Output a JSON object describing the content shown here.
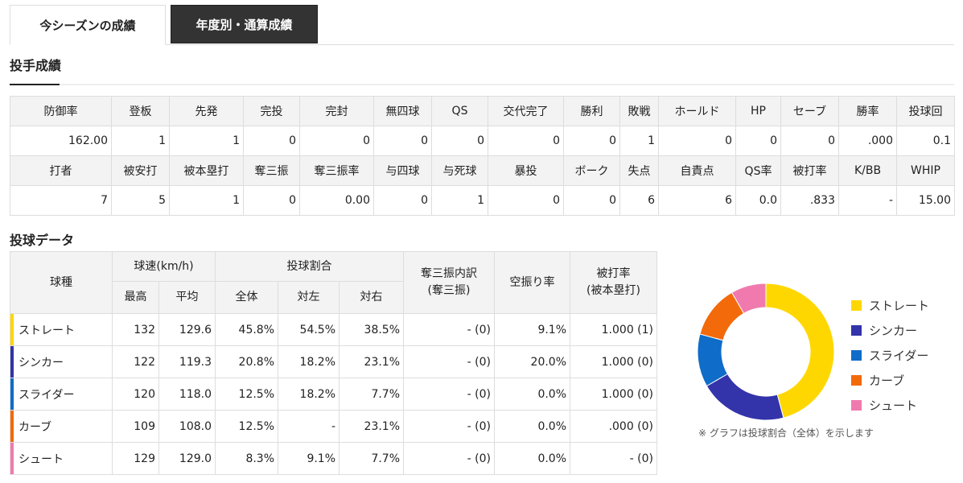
{
  "tabs": [
    {
      "label": "今シーズンの成績",
      "active": true
    },
    {
      "label": "年度別・通算成績",
      "active": false
    }
  ],
  "section_pitching": "投手成績",
  "stats": {
    "headers1": [
      "防御率",
      "登板",
      "先発",
      "完投",
      "完封",
      "無四球",
      "QS",
      "交代完了",
      "勝利",
      "敗戦",
      "ホールド",
      "HP",
      "セーブ",
      "勝率",
      "投球回"
    ],
    "values1": [
      "162.00",
      "1",
      "1",
      "0",
      "0",
      "0",
      "0",
      "0",
      "0",
      "1",
      "0",
      "0",
      "0",
      ".000",
      "0.1"
    ],
    "headers2": [
      "打者",
      "被安打",
      "被本塁打",
      "奪三振",
      "奪三振率",
      "与四球",
      "与死球",
      "暴投",
      "ボーク",
      "失点",
      "自責点",
      "QS率",
      "被打率",
      "K/BB",
      "WHIP"
    ],
    "values2": [
      "7",
      "5",
      "1",
      "0",
      "0.00",
      "0",
      "1",
      "0",
      "0",
      "6",
      "6",
      "0.0",
      ".833",
      "-",
      "15.00"
    ]
  },
  "section_pitch_data": "投球データ",
  "pitch_table": {
    "col_pitch_type": "球種",
    "col_speed": "球速(km/h)",
    "col_speed_max": "最高",
    "col_speed_avg": "平均",
    "col_ratio": "投球割合",
    "col_ratio_all": "全体",
    "col_ratio_left": "対左",
    "col_ratio_right": "対右",
    "col_strikeout": "奪三振内訳",
    "col_strikeout_sub": "(奪三振)",
    "col_whiff": "空振り率",
    "col_avg": "被打率",
    "col_avg_sub": "(被本塁打)",
    "rows": [
      {
        "name": "ストレート",
        "max": "132",
        "avg": "129.6",
        "all": "45.8%",
        "left": "54.5%",
        "right": "38.5%",
        "so": "- (0)",
        "whiff": "9.1%",
        "ba": "1.000 (1)"
      },
      {
        "name": "シンカー",
        "max": "122",
        "avg": "119.3",
        "all": "20.8%",
        "left": "18.2%",
        "right": "23.1%",
        "so": "- (0)",
        "whiff": "20.0%",
        "ba": "1.000 (0)"
      },
      {
        "name": "スライダー",
        "max": "120",
        "avg": "118.0",
        "all": "12.5%",
        "left": "18.2%",
        "right": "7.7%",
        "so": "- (0)",
        "whiff": "0.0%",
        "ba": "1.000 (0)"
      },
      {
        "name": "カーブ",
        "max": "109",
        "avg": "108.0",
        "all": "12.5%",
        "left": "-",
        "right": "23.1%",
        "so": "- (0)",
        "whiff": "0.0%",
        "ba": ".000 (0)"
      },
      {
        "name": "シュート",
        "max": "129",
        "avg": "129.0",
        "all": "8.3%",
        "left": "9.1%",
        "right": "7.7%",
        "so": "- (0)",
        "whiff": "0.0%",
        "ba": "- (0)"
      }
    ]
  },
  "chart_data": {
    "type": "pie",
    "categories": [
      "ストレート",
      "シンカー",
      "スライダー",
      "カーブ",
      "シュート"
    ],
    "values": [
      45.8,
      20.8,
      12.5,
      12.5,
      8.3
    ],
    "colors": [
      "#ffd700",
      "#3333aa",
      "#0f6cc8",
      "#f26a0a",
      "#f07aae"
    ],
    "legend": "right",
    "note": "※ グラフは投球割合（全体）を示します"
  }
}
